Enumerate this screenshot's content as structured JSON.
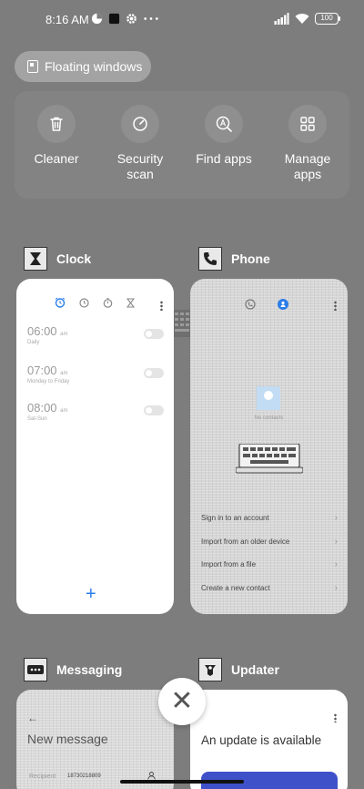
{
  "status_bar": {
    "time": "8:16 AM",
    "battery": "100",
    "left_icons": [
      "data-saver-icon",
      "notification-square-icon",
      "settings-gear-icon",
      "more-dots-icon"
    ],
    "right_icons": [
      "signal-icon",
      "wifi-icon",
      "battery-icon"
    ]
  },
  "floating_windows": {
    "label": "Floating windows"
  },
  "tools": [
    {
      "label": "Cleaner",
      "icon": "trash-icon"
    },
    {
      "label": "Security\nscan",
      "icon": "security-scan-icon"
    },
    {
      "label": "Find apps",
      "icon": "find-apps-icon"
    },
    {
      "label": "Manage\napps",
      "icon": "grid-icon"
    }
  ],
  "apps": {
    "clock": {
      "name": "Clock",
      "alarms": [
        {
          "time": "06:00",
          "ampm": "am",
          "days": "Daily"
        },
        {
          "time": "07:00",
          "ampm": "am",
          "days": "Monday to Friday"
        },
        {
          "time": "08:00",
          "ampm": "am",
          "days": "Sat-Sun"
        }
      ],
      "add": "+"
    },
    "phone": {
      "name": "Phone",
      "empty_text": "No contacts",
      "menu": [
        "Sign in to an account",
        "Import from an older device",
        "Import from a file",
        "Create a new contact"
      ]
    },
    "messaging": {
      "name": "Messaging",
      "back": "←",
      "title": "New message",
      "recipient_label": "Recipient",
      "recipient_value": "18730218809"
    },
    "updater": {
      "name": "Updater",
      "title": "An update is available"
    }
  },
  "close": "✕",
  "colors": {
    "background": "#7d7d7d",
    "accent": "#2b7de9"
  }
}
